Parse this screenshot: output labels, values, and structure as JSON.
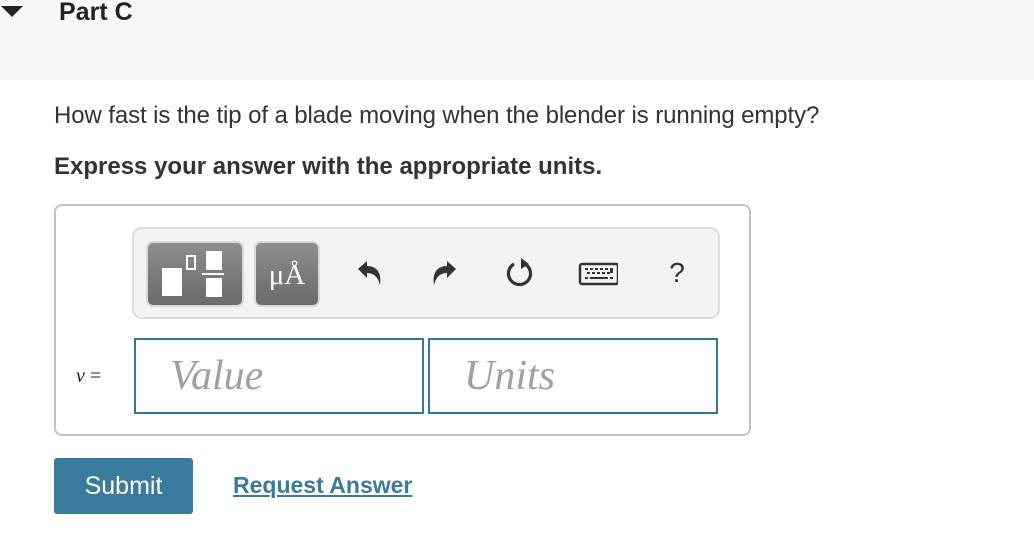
{
  "part": {
    "title": "Part C",
    "collapse_icon": "triangle-down-icon"
  },
  "question": {
    "text": "How fast is the tip of a blade moving when the blender is running empty?",
    "instruction": "Express your answer with the appropriate units."
  },
  "toolbar": {
    "templates_icon": "templates-icon",
    "units_glyph": "μÅ",
    "undo_icon": "undo-icon",
    "redo_icon": "redo-icon",
    "reset_icon": "reset-icon",
    "keyboard_icon": "keyboard-icon",
    "help_label": "?"
  },
  "answer": {
    "variable": "v",
    "equals": "=",
    "value_placeholder": "Value",
    "value": "",
    "units_placeholder": "Units",
    "units": ""
  },
  "actions": {
    "submit_label": "Submit",
    "request_answer_label": "Request Answer"
  },
  "colors": {
    "accent": "#3a7a9c",
    "header_bg": "#f8f8f8",
    "toolbar_bg": "#f3f3f3"
  }
}
